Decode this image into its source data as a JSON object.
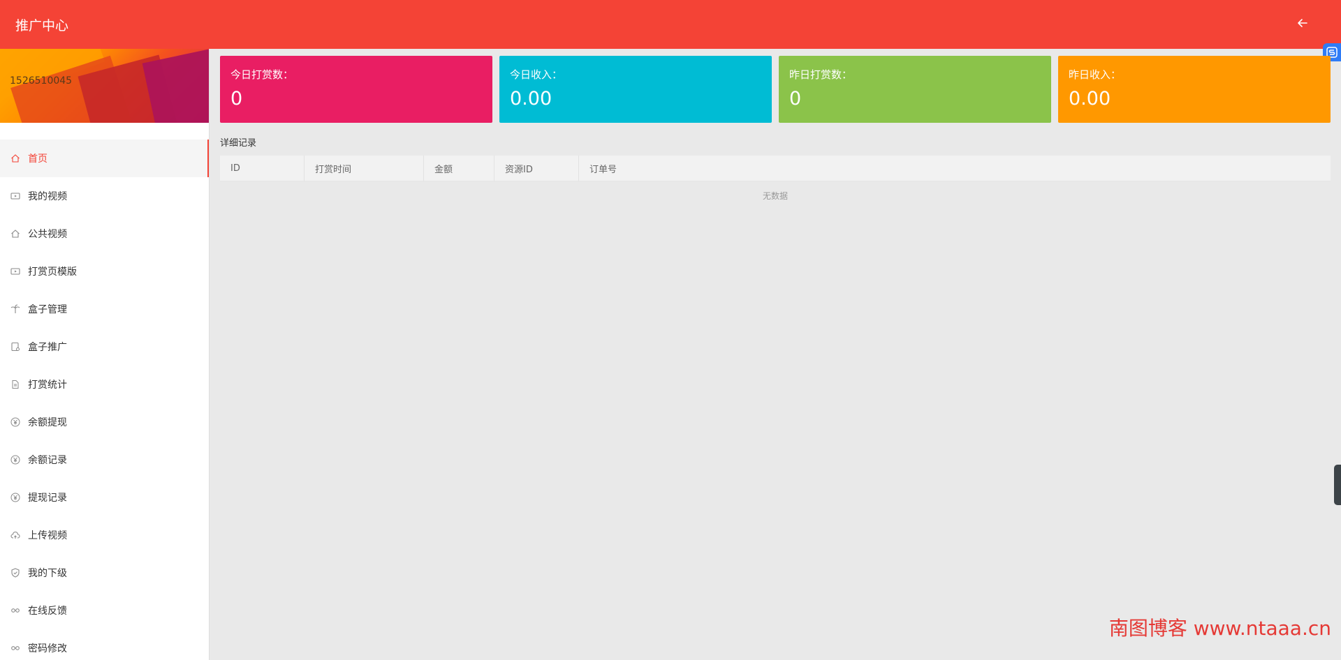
{
  "header": {
    "title": "推广中心",
    "back_icon": "arrow-left-icon"
  },
  "user": {
    "name": "1526510045"
  },
  "sidebar": {
    "items": [
      {
        "label": "首页",
        "icon": "home-icon",
        "active": true
      },
      {
        "label": "我的视频",
        "icon": "video-icon"
      },
      {
        "label": "公共视频",
        "icon": "home-icon"
      },
      {
        "label": "打赏页模版",
        "icon": "video-icon"
      },
      {
        "label": "盒子管理",
        "icon": "palm-icon"
      },
      {
        "label": "盒子推广",
        "icon": "page-icon"
      },
      {
        "label": "打赏统计",
        "icon": "doc-icon"
      },
      {
        "label": "余额提现",
        "icon": "yen-icon"
      },
      {
        "label": "余额记录",
        "icon": "yen-icon"
      },
      {
        "label": "提现记录",
        "icon": "yen-icon"
      },
      {
        "label": "上传视频",
        "icon": "cloud-upload-icon"
      },
      {
        "label": "我的下级",
        "icon": "shield-icon"
      },
      {
        "label": "在线反馈",
        "icon": "link-icon"
      },
      {
        "label": "密码修改",
        "icon": "link-icon"
      }
    ]
  },
  "stats": {
    "cards": [
      {
        "label": "今日打赏数：",
        "value": "0",
        "color": "#e91e63"
      },
      {
        "label": "今日收入：",
        "value": "0.00",
        "color": "#00bcd4"
      },
      {
        "label": "昨日打赏数：",
        "value": "0",
        "color": "#8bc34a"
      },
      {
        "label": "昨日收入：",
        "value": "0.00",
        "color": "#ff9800"
      }
    ]
  },
  "records": {
    "title": "详细记录",
    "columns": [
      "ID",
      "打赏时间",
      "金额",
      "资源ID",
      "订单号"
    ],
    "empty_text": "无数据"
  },
  "watermark": {
    "text": "南图博客 www.ntaaa.cn"
  },
  "colors": {
    "accent": "#f44336"
  }
}
